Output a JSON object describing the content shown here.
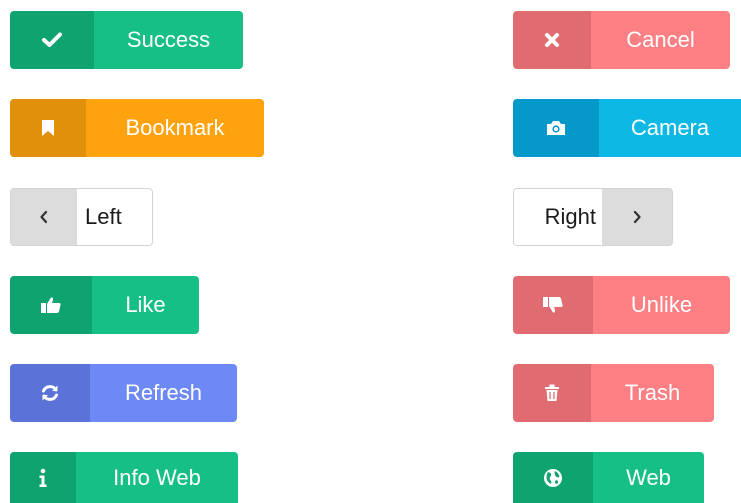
{
  "buttons": {
    "success": {
      "label": "Success",
      "icon": "check-icon",
      "icon_bg": "#0fa36f",
      "label_bg": "#16bf85"
    },
    "cancel": {
      "label": "Cancel",
      "icon": "close-icon",
      "icon_bg": "#e06b70",
      "label_bg": "#fb7f83"
    },
    "bookmark": {
      "label": "Bookmark",
      "icon": "bookmark-icon",
      "icon_bg": "#e0900a",
      "label_bg": "#ffa20f"
    },
    "camera": {
      "label": "Camera",
      "icon": "camera-icon",
      "icon_bg": "#0599c9",
      "label_bg": "#0eb8e5"
    },
    "left": {
      "label": "Left",
      "icon": "chevron-left-icon"
    },
    "right": {
      "label": "Right",
      "icon": "chevron-right-icon"
    },
    "like": {
      "label": "Like",
      "icon": "thumbs-up-icon",
      "icon_bg": "#0fa36f",
      "label_bg": "#16bf85"
    },
    "unlike": {
      "label": "Unlike",
      "icon": "thumbs-down-icon",
      "icon_bg": "#e06b70",
      "label_bg": "#fb7f83"
    },
    "refresh": {
      "label": "Refresh",
      "icon": "refresh-icon",
      "icon_bg": "#5b73d8",
      "label_bg": "#6d89f5"
    },
    "trash": {
      "label": "Trash",
      "icon": "trash-icon",
      "icon_bg": "#e06b70",
      "label_bg": "#fb7f83"
    },
    "info_web": {
      "label": "Info Web",
      "icon": "info-icon",
      "icon_bg": "#0fa36f",
      "label_bg": "#16bf85"
    },
    "web": {
      "label": "Web",
      "icon": "globe-icon",
      "icon_bg": "#0fa36f",
      "label_bg": "#16bf85"
    }
  }
}
